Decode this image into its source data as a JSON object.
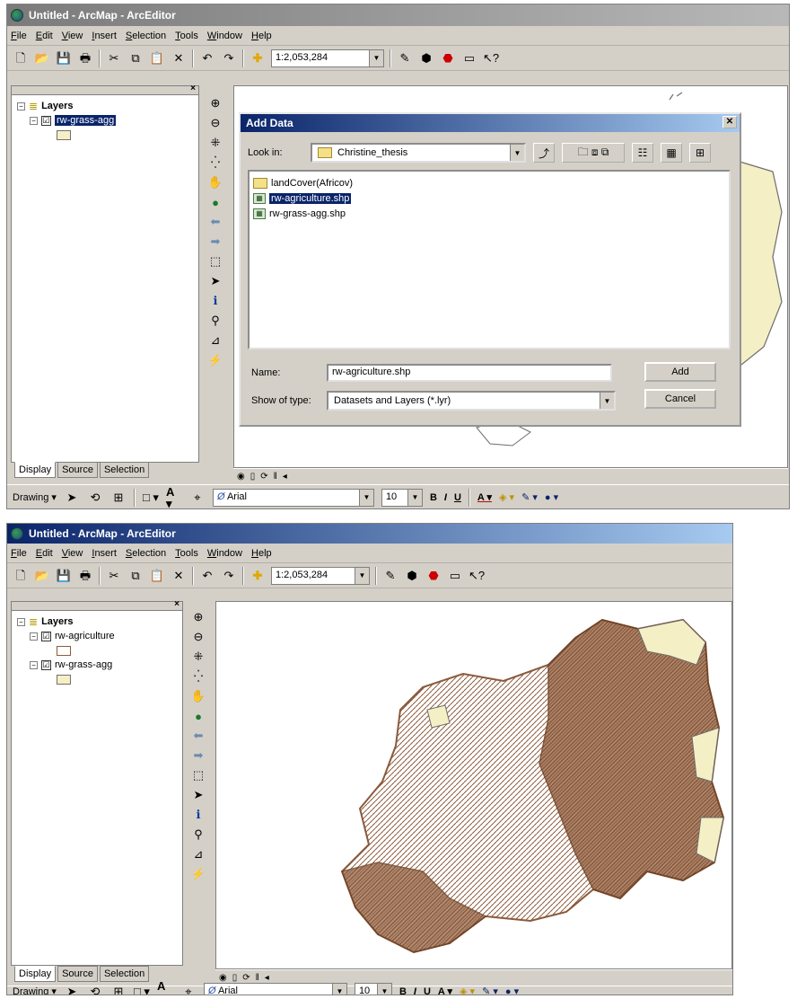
{
  "window_top": {
    "title": "Untitled - ArcMap - ArcEditor",
    "menu": [
      "File",
      "Edit",
      "View",
      "Insert",
      "Selection",
      "Tools",
      "Window",
      "Help"
    ],
    "scale": "1:2,053,284",
    "toc": {
      "root": "Layers",
      "layers": [
        {
          "name": "rw-grass-agg",
          "checked": "☑",
          "swatch": "#f5efc5"
        }
      ]
    },
    "tabs": [
      "Display",
      "Source",
      "Selection"
    ],
    "drawing": {
      "label": "Drawing",
      "font": "Arial",
      "size": "10",
      "bold": "B",
      "italic": "I",
      "underline": "U"
    },
    "dialog": {
      "title": "Add Data",
      "look_in_label": "Look in:",
      "look_in_value": "Christine_thesis",
      "files": [
        {
          "name": "landCover(Africov)",
          "icon": "folder-icon"
        },
        {
          "name": "rw-agriculture.shp",
          "icon": "shapefile-icon",
          "selected": true
        },
        {
          "name": "rw-grass-agg.shp",
          "icon": "shapefile-icon"
        }
      ],
      "name_label": "Name:",
      "name_value": "rw-agriculture.shp",
      "type_label": "Show of type:",
      "type_value": "Datasets and Layers (*.lyr)",
      "add_button": "Add",
      "cancel_button": "Cancel"
    }
  },
  "window_bottom": {
    "title": "Untitled - ArcMap - ArcEditor",
    "menu": [
      "File",
      "Edit",
      "View",
      "Insert",
      "Selection",
      "Tools",
      "Window",
      "Help"
    ],
    "scale": "1:2,053,284",
    "toc": {
      "root": "Layers",
      "layers": [
        {
          "name": "rw-agriculture",
          "checked": "☑",
          "swatch": "#ffffff"
        },
        {
          "name": "rw-grass-agg",
          "checked": "☑",
          "swatch": "#f5efc5"
        }
      ]
    },
    "tabs": [
      "Display",
      "Source",
      "Selection"
    ],
    "drawing": {
      "label": "Drawing",
      "font": "Arial",
      "size": "10",
      "bold": "B",
      "italic": "I",
      "underline": "U"
    }
  },
  "colors": {
    "agriculture": "#8b5a3c",
    "grass": "#f5efc5",
    "boundary": "#6d6d6d"
  }
}
